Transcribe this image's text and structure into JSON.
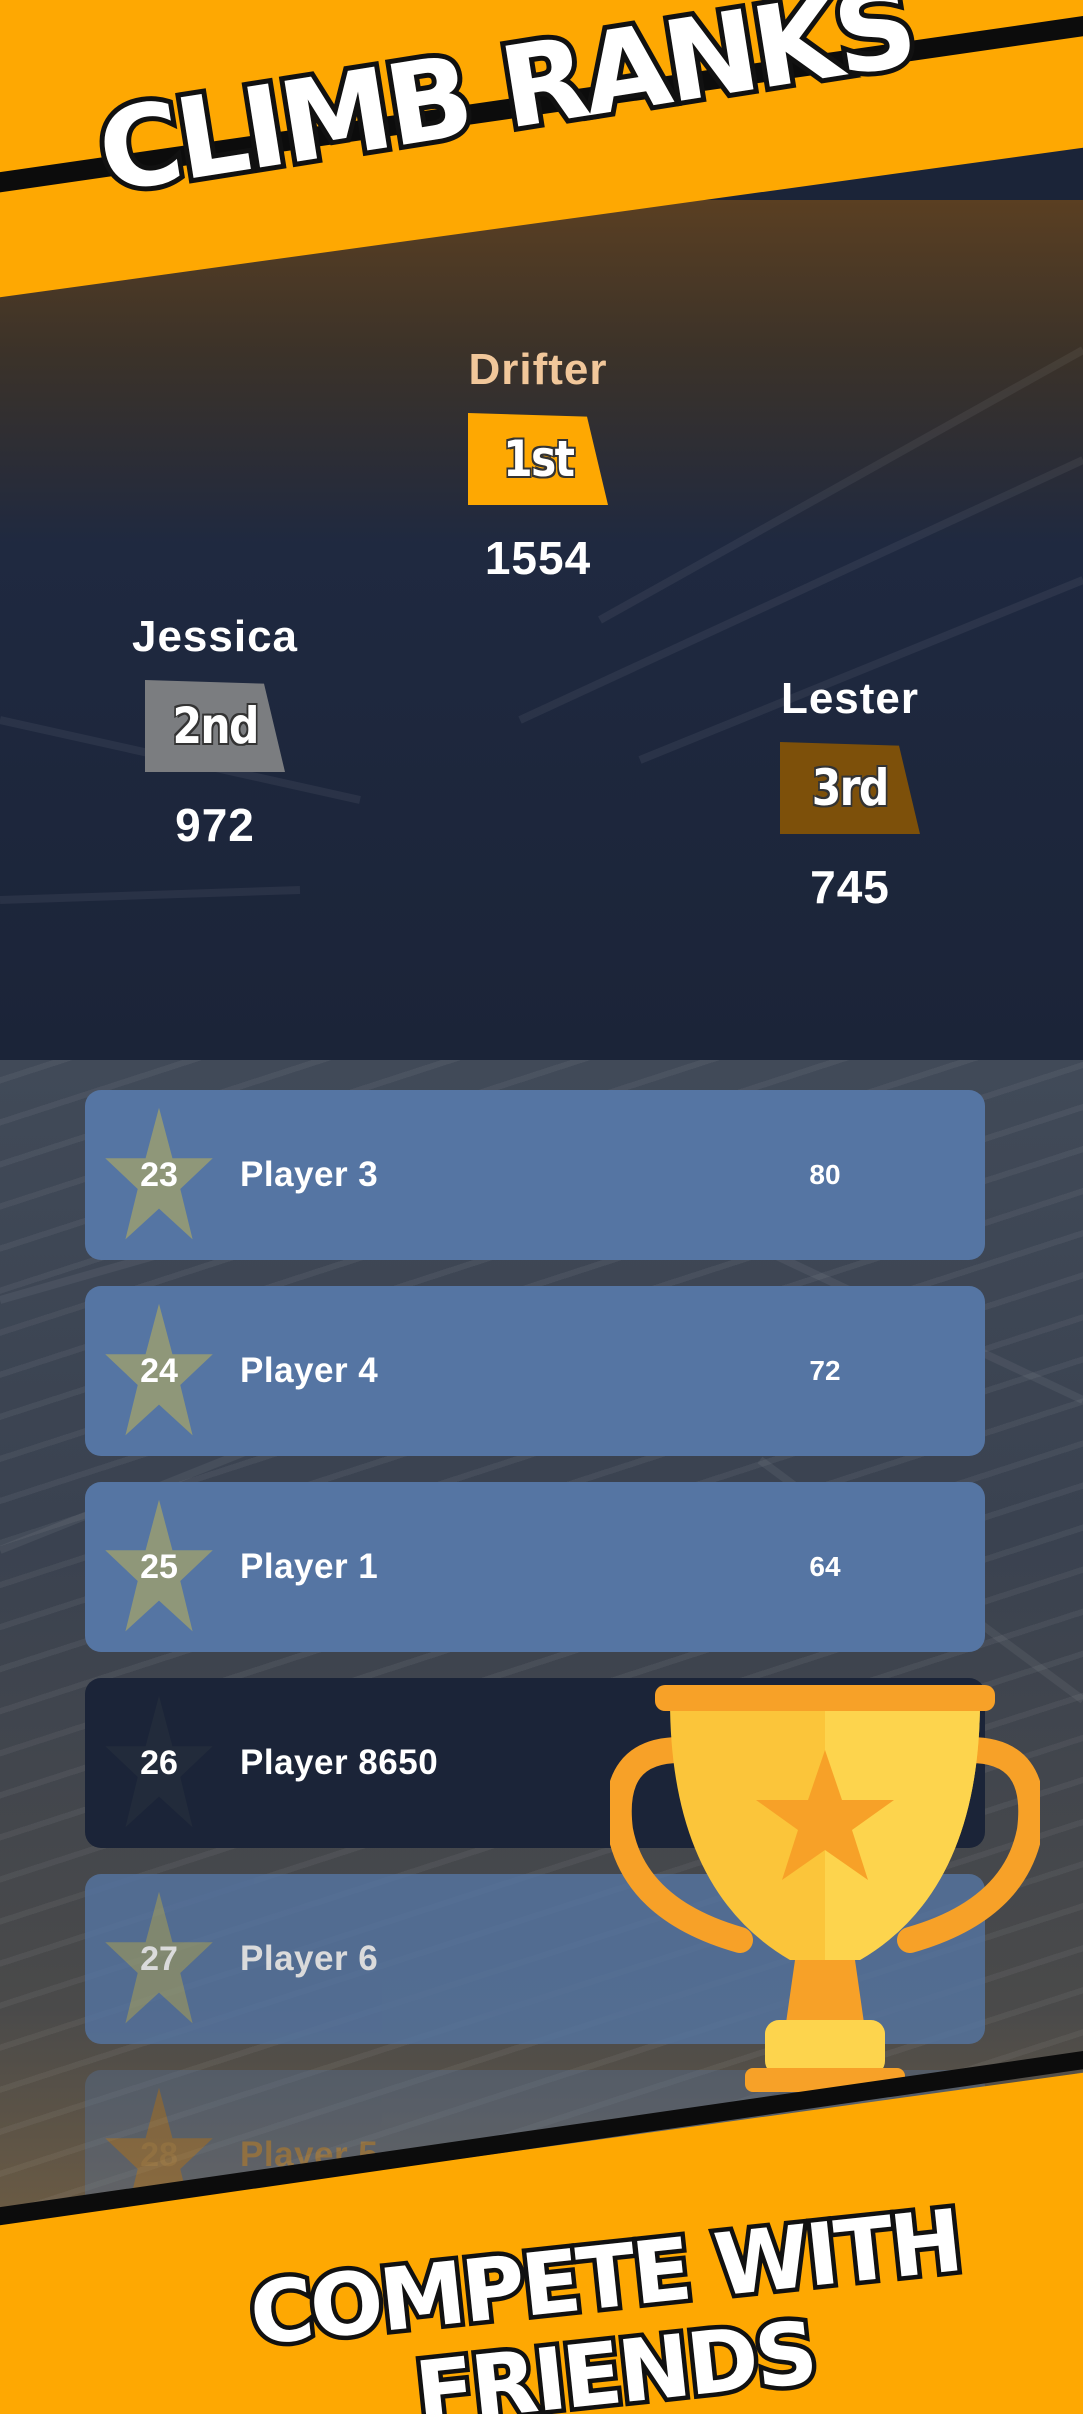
{
  "header": {
    "title": "CLIMB RANKS"
  },
  "podium": [
    {
      "place": "1st",
      "name": "Drifter",
      "score": "1554",
      "name_color": "#f1c79a",
      "badge_color": "#fea802"
    },
    {
      "place": "2nd",
      "name": "Jessica",
      "score": "972",
      "name_color": "#ffffff",
      "badge_color": "#7b7d80"
    },
    {
      "place": "3rd",
      "name": "Lester",
      "score": "745",
      "name_color": "#ffffff",
      "badge_color": "#7d500a"
    }
  ],
  "leaderboard": {
    "rows": [
      {
        "rank": "23",
        "name": "Player 3",
        "score": "80"
      },
      {
        "rank": "24",
        "name": "Player 4",
        "score": "72"
      },
      {
        "rank": "25",
        "name": "Player 1",
        "score": "64"
      },
      {
        "rank": "26",
        "name": "Player 8650",
        "score": "",
        "highlighted": true
      },
      {
        "rank": "27",
        "name": "Player 6",
        "score": ""
      },
      {
        "rank": "28",
        "name": "Player 5",
        "score": ""
      }
    ]
  },
  "footer": {
    "title_line1": "COMPETE WITH",
    "title_line2": "FRIENDS"
  },
  "icons": [
    "star-icon",
    "trophy-icon"
  ],
  "colors": {
    "accent": "#fea802",
    "row": "#5575a3",
    "row_highlight": "#1b2438",
    "star": "#8f9779"
  }
}
